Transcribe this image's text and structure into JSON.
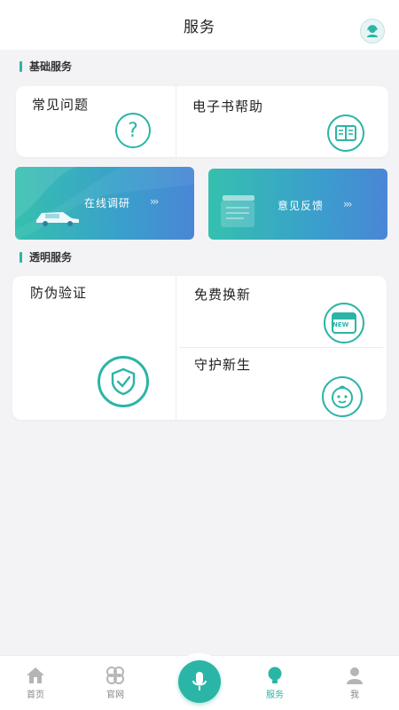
{
  "header": {
    "title": "服务",
    "cs_icon": "customer-service-icon"
  },
  "basic": {
    "title": "基础服务",
    "faq": {
      "label": "常见问题",
      "icon": "question-icon"
    },
    "ebook": {
      "label": "电子书帮助",
      "icon": "book-icon"
    },
    "research": {
      "label": "在线调研",
      "chevrons": "›››"
    },
    "feedback": {
      "label": "意见反馈",
      "chevrons": "›››"
    }
  },
  "transparent": {
    "title": "透明服务",
    "anti_fake": {
      "label": "防伪验证",
      "icon": "shield-check-icon"
    },
    "renew": {
      "label": "免费换新",
      "icon": "new-box-icon",
      "badge": "NEW"
    },
    "guard": {
      "label": "守护新生",
      "icon": "baby-face-icon"
    }
  },
  "tabbar": {
    "home": "首页",
    "site": "官网",
    "service": "服务",
    "me": "我"
  },
  "colors": {
    "accent": "#2bb5a6"
  }
}
